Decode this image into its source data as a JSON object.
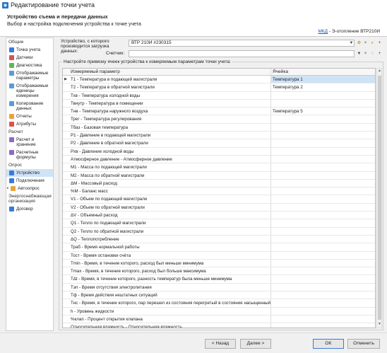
{
  "window": {
    "title": "Редактирование точки учета",
    "icon": "meter-icon"
  },
  "header": {
    "title": "Устройство съема и передачи данных",
    "subtitle": "Выбор и настройка подключения устройства к точке учета",
    "link_text": "МКД",
    "link_suffix": " - Э-отопление ВТР210И"
  },
  "sidebar": {
    "group_general": "Общие",
    "items_general": [
      {
        "label": "Точка учета",
        "icon": "point-icon",
        "color": "#3a7bd5"
      },
      {
        "label": "Датчики",
        "icon": "sensor-icon",
        "color": "#d9534f"
      },
      {
        "label": "Диагностика",
        "icon": "diagnostics-icon",
        "color": "#5cb85c"
      },
      {
        "label": "Отображаемые параметры",
        "icon": "params-icon",
        "color": "#5b9bd5"
      },
      {
        "label": "Отображаемые единицы измерения",
        "icon": "units-icon",
        "color": "#5b9bd5"
      },
      {
        "label": "Копирование данных",
        "icon": "copy-icon",
        "color": "#5b9bd5"
      },
      {
        "label": "Отчеты",
        "icon": "report-icon",
        "color": "#e8a33d"
      },
      {
        "label": "Атрибуты",
        "icon": "attributes-icon",
        "color": "#d9534f"
      }
    ],
    "group_calc": "Расчет",
    "items_calc": [
      {
        "label": "Расчет и хранение",
        "icon": "calc-icon",
        "color": "#8e6bbf"
      },
      {
        "label": "Расчетные формулы",
        "icon": "formula-icon",
        "color": "#8e6bbf"
      }
    ],
    "group_poll": "Опрос",
    "items_poll": [
      {
        "label": "Устройство",
        "icon": "device-icon",
        "color": "#3a7bd5",
        "selected": true
      },
      {
        "label": "Подключения",
        "icon": "connection-icon",
        "color": "#3a7bd5"
      },
      {
        "label": "Автоопрос",
        "icon": "autopoll-icon",
        "color": "#e8a33d"
      }
    ],
    "group_energy": "Энергоснабжающая организация",
    "items_energy": [
      {
        "label": "Договор",
        "icon": "contract-icon",
        "color": "#3a7bd5"
      }
    ]
  },
  "form": {
    "device_label": "Устройство, с которого производится загрузка данных:",
    "device_value": "ВТР 210И #230315",
    "counter_label": "Счетчик:",
    "counter_value": "",
    "group_legend": "Настройте привязку ячеек устройства к измеряемым параметрам точки учета:"
  },
  "table": {
    "col_param": "Измеряемый параметр",
    "col_cell": "Ячейка",
    "rows": [
      {
        "param": "Т1 - Температура в подающей магистрали",
        "cell": "Температура 1"
      },
      {
        "param": "Т2 - Температура в обратной магистрали",
        "cell": "Температура 2"
      },
      {
        "param": "Тхв - Температура холодной воды",
        "cell": ""
      },
      {
        "param": "Твнутр - Температура в помещении",
        "cell": ""
      },
      {
        "param": "Тнв - Температура наружного воздуха",
        "cell": "Температура 5"
      },
      {
        "param": "Трег - Температура регулирования",
        "cell": ""
      },
      {
        "param": "Тбаз - Базовая температура",
        "cell": ""
      },
      {
        "param": "Р1 - Давление в подающей магистрали",
        "cell": ""
      },
      {
        "param": "Р2 - Давление в обратной магистрали",
        "cell": ""
      },
      {
        "param": "Рхв - Давление холодной воды",
        "cell": ""
      },
      {
        "param": "Атмосферное давление - Атмосферное давление",
        "cell": ""
      },
      {
        "param": "М1 - Масса по подающей магистрали",
        "cell": ""
      },
      {
        "param": "М2 - Масса по обратной магистрали",
        "cell": ""
      },
      {
        "param": "ΔМ - Массовый расход",
        "cell": ""
      },
      {
        "param": "%М - Баланс масс",
        "cell": ""
      },
      {
        "param": "V1 - Объем по подающей магистрали",
        "cell": ""
      },
      {
        "param": "V2 - Объем по обратной магистрали",
        "cell": ""
      },
      {
        "param": "ΔV - Объемный расход",
        "cell": ""
      },
      {
        "param": "Q1 - Тепло по подающей магистрали",
        "cell": ""
      },
      {
        "param": "Q2 - Тепло по обратной магистрали",
        "cell": ""
      },
      {
        "param": "ΔQ - Теплопотребление",
        "cell": ""
      },
      {
        "param": "Траб - Время нормальной работы",
        "cell": ""
      },
      {
        "param": "Тост - Время остановки счёта",
        "cell": ""
      },
      {
        "param": "Tmin - Время, в течение которого, расход был меньше минимума",
        "cell": ""
      },
      {
        "param": "Tmax - Время, в течение которого, расход был больше максимума",
        "cell": ""
      },
      {
        "param": "ТΔt - Время, в течение которого, разность температур была меньше минимума",
        "cell": ""
      },
      {
        "param": "Тэп - Время отсутствия электропитания",
        "cell": ""
      },
      {
        "param": "Тф - Время действия нештатных ситуаций",
        "cell": ""
      },
      {
        "param": "Тнс - Время, в течение которого, пар перешел из состояния перегретый в состояние насыщенный",
        "cell": ""
      },
      {
        "param": "h - Уровень жидкости",
        "cell": ""
      },
      {
        "param": "%клап - Процент открытия клапана",
        "cell": ""
      },
      {
        "param": "Относительная влажность - Относительная влажность",
        "cell": ""
      }
    ]
  },
  "footer": {
    "back": "< Назад",
    "next": "Далее >",
    "ok": "OK",
    "cancel": "Отменить"
  }
}
